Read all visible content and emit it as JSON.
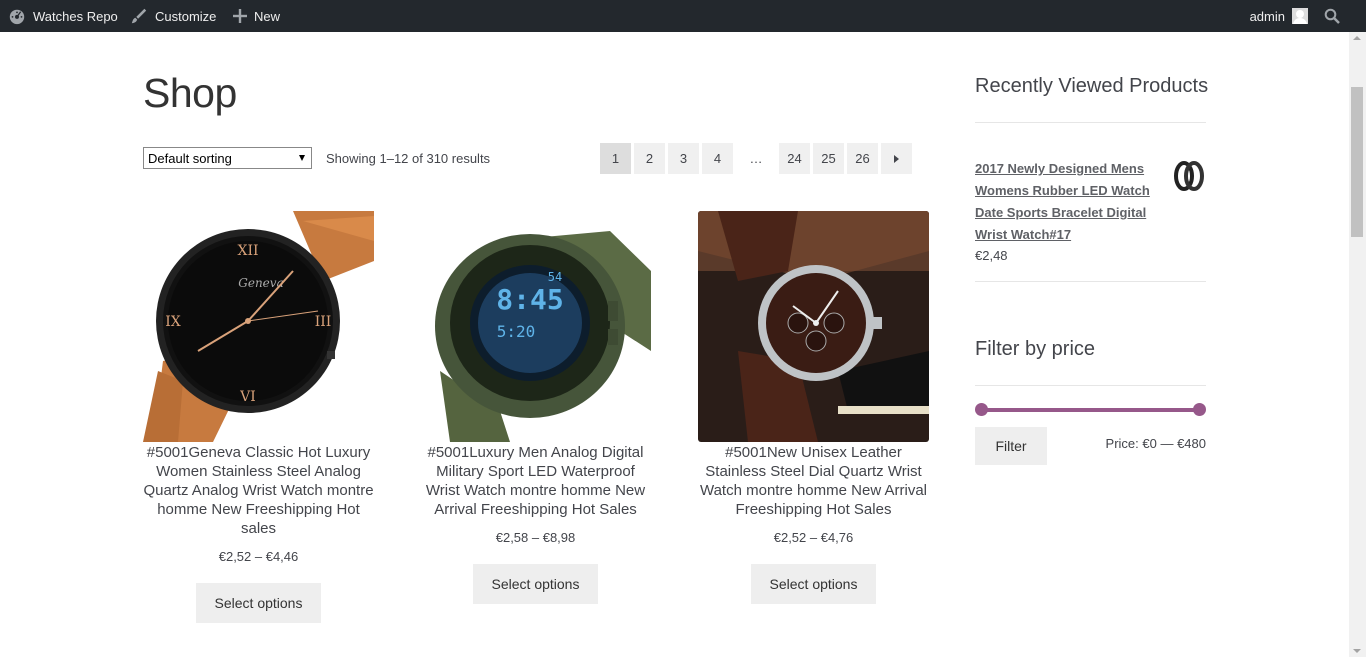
{
  "admin_bar": {
    "site_name": "Watches Repo",
    "customize": "Customize",
    "new": "New",
    "user": "admin"
  },
  "shop": {
    "title": "Shop",
    "sorting": "Default sorting",
    "result_count": "Showing 1–12 of 310 results",
    "pagination": [
      "1",
      "2",
      "3",
      "4",
      "…",
      "24",
      "25",
      "26"
    ]
  },
  "products": [
    {
      "title": "#5001Geneva Classic Hot Luxury Women Stainless Steel Analog Quartz Analog Wrist Watch montre homme New Freeshipping Hot sales",
      "price": "€2,52 – €4,46",
      "button": "Select options"
    },
    {
      "title": "#5001Luxury Men Analog Digital Military Sport LED Waterproof Wrist Watch montre homme New Arrival Freeshipping Hot Sales",
      "price": "€2,58 – €8,98",
      "button": "Select options"
    },
    {
      "title": "#5001New Unisex Leather Stainless Steel Dial Quartz Wrist Watch montre homme New Arrival Freeshipping Hot Sales",
      "price": "€2,52 – €4,76",
      "button": "Select options"
    }
  ],
  "sidebar": {
    "recently_viewed_title": "Recently Viewed Products",
    "recent_product_title": "2017 Newly Designed Mens Womens Rubber LED Watch Date Sports Bracelet Digital Wrist Watch#17",
    "recent_product_price": "€2,48",
    "filter_title": "Filter by price",
    "filter_button": "Filter",
    "price_range": "Price: €0 — €480"
  },
  "colors": {
    "admin_bar": "#23282d",
    "accent": "#96588a",
    "button_bg": "#eeeeee"
  }
}
